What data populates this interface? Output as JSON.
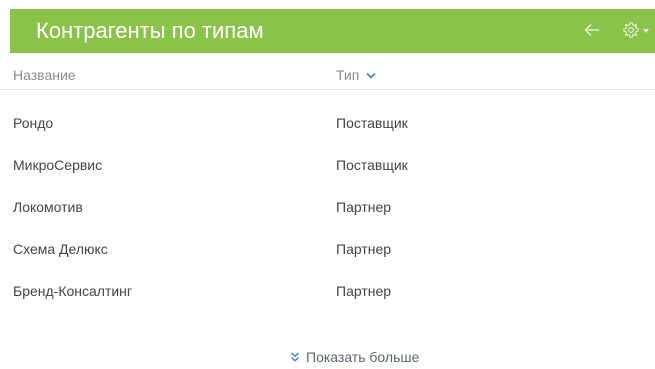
{
  "widget": {
    "title": "Контрагенты по типам",
    "header_color": "#8bc34a",
    "back_icon": "arrow-left-icon",
    "settings_icon": "gear-icon"
  },
  "columns": {
    "name": "Название",
    "type": "Тип",
    "type_sort_icon": "chevron-down-icon"
  },
  "rows": [
    {
      "name": "Рондо",
      "type": "Поставщик"
    },
    {
      "name": "МикроСервис",
      "type": "Поставщик"
    },
    {
      "name": "Локомотив",
      "type": "Партнер"
    },
    {
      "name": "Схема Делюкс",
      "type": "Партнер"
    },
    {
      "name": "Бренд-Консалтинг",
      "type": "Партнер"
    }
  ],
  "footer": {
    "show_more_label": "Показать больше",
    "show_more_icon": "double-chevron-down-icon"
  }
}
